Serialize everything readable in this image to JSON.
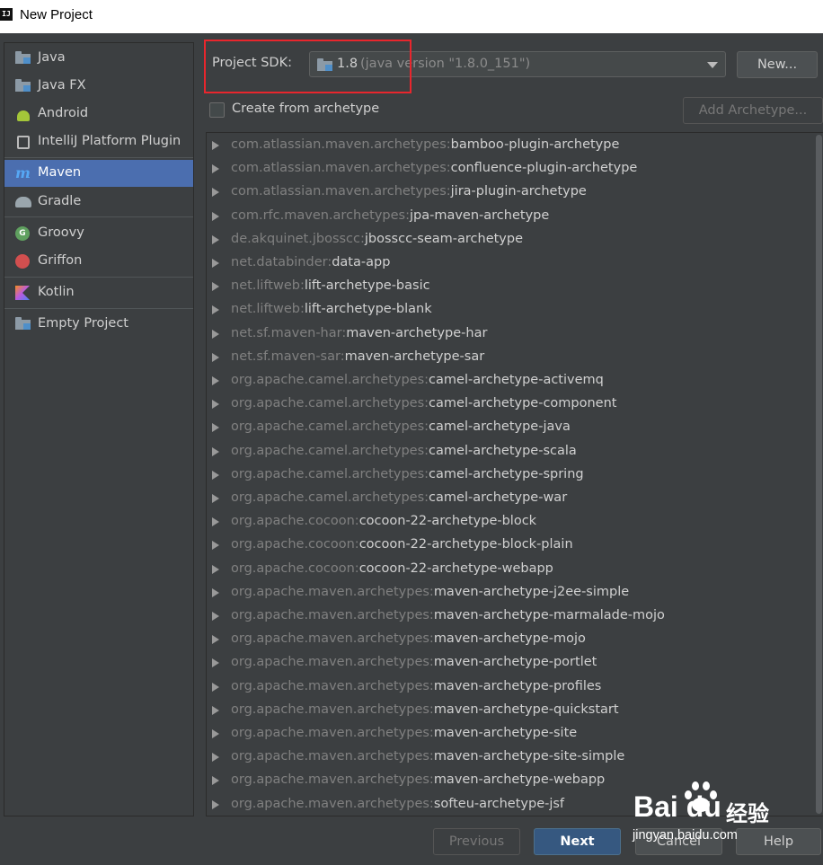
{
  "window": {
    "title": "New Project",
    "app_icon_text": "IJ"
  },
  "sidebar": {
    "items": [
      {
        "label": "Java",
        "icon": "folder-icon"
      },
      {
        "label": "Java FX",
        "icon": "folder-icon"
      },
      {
        "label": "Android",
        "icon": "android-icon"
      },
      {
        "label": "IntelliJ Platform Plugin",
        "icon": "intellij-plugin-icon"
      },
      {
        "label": "Maven",
        "icon": "maven-icon",
        "selected": true
      },
      {
        "label": "Gradle",
        "icon": "gradle-icon"
      },
      {
        "label": "Groovy",
        "icon": "groovy-icon"
      },
      {
        "label": "Griffon",
        "icon": "griffon-icon"
      },
      {
        "label": "Kotlin",
        "icon": "kotlin-icon"
      },
      {
        "label": "Empty Project",
        "icon": "folder-icon"
      }
    ]
  },
  "sdk": {
    "label": "Project SDK:",
    "value": "1.8",
    "hint": "(java version \"1.8.0_151\")",
    "new_button": "New..."
  },
  "archetype": {
    "checkbox_label": "Create from archetype",
    "checked": false,
    "add_button": "Add Archetype..."
  },
  "archetypes": [
    {
      "group": "com.atlassian.maven.archetypes:",
      "artifact": "bamboo-plugin-archetype"
    },
    {
      "group": "com.atlassian.maven.archetypes:",
      "artifact": "confluence-plugin-archetype"
    },
    {
      "group": "com.atlassian.maven.archetypes:",
      "artifact": "jira-plugin-archetype"
    },
    {
      "group": "com.rfc.maven.archetypes:",
      "artifact": "jpa-maven-archetype"
    },
    {
      "group": "de.akquinet.jbosscc:",
      "artifact": "jbosscc-seam-archetype"
    },
    {
      "group": "net.databinder:",
      "artifact": "data-app"
    },
    {
      "group": "net.liftweb:",
      "artifact": "lift-archetype-basic"
    },
    {
      "group": "net.liftweb:",
      "artifact": "lift-archetype-blank"
    },
    {
      "group": "net.sf.maven-har:",
      "artifact": "maven-archetype-har"
    },
    {
      "group": "net.sf.maven-sar:",
      "artifact": "maven-archetype-sar"
    },
    {
      "group": "org.apache.camel.archetypes:",
      "artifact": "camel-archetype-activemq"
    },
    {
      "group": "org.apache.camel.archetypes:",
      "artifact": "camel-archetype-component"
    },
    {
      "group": "org.apache.camel.archetypes:",
      "artifact": "camel-archetype-java"
    },
    {
      "group": "org.apache.camel.archetypes:",
      "artifact": "camel-archetype-scala"
    },
    {
      "group": "org.apache.camel.archetypes:",
      "artifact": "camel-archetype-spring"
    },
    {
      "group": "org.apache.camel.archetypes:",
      "artifact": "camel-archetype-war"
    },
    {
      "group": "org.apache.cocoon:",
      "artifact": "cocoon-22-archetype-block"
    },
    {
      "group": "org.apache.cocoon:",
      "artifact": "cocoon-22-archetype-block-plain"
    },
    {
      "group": "org.apache.cocoon:",
      "artifact": "cocoon-22-archetype-webapp"
    },
    {
      "group": "org.apache.maven.archetypes:",
      "artifact": "maven-archetype-j2ee-simple"
    },
    {
      "group": "org.apache.maven.archetypes:",
      "artifact": "maven-archetype-marmalade-mojo"
    },
    {
      "group": "org.apache.maven.archetypes:",
      "artifact": "maven-archetype-mojo"
    },
    {
      "group": "org.apache.maven.archetypes:",
      "artifact": "maven-archetype-portlet"
    },
    {
      "group": "org.apache.maven.archetypes:",
      "artifact": "maven-archetype-profiles"
    },
    {
      "group": "org.apache.maven.archetypes:",
      "artifact": "maven-archetype-quickstart"
    },
    {
      "group": "org.apache.maven.archetypes:",
      "artifact": "maven-archetype-site"
    },
    {
      "group": "org.apache.maven.archetypes:",
      "artifact": "maven-archetype-site-simple"
    },
    {
      "group": "org.apache.maven.archetypes:",
      "artifact": "maven-archetype-webapp"
    },
    {
      "group": "org.apache.maven.archetypes:",
      "artifact": "softeu-archetype-jsf"
    }
  ],
  "footer": {
    "previous": "Previous",
    "next": "Next",
    "cancel": "Cancel",
    "help": "Help"
  },
  "watermark": {
    "brand": "Bai du",
    "cn": "经验",
    "url": "jingyan.baidu.com"
  },
  "colors": {
    "background": "#3c3f41",
    "selection": "#4b6eaf",
    "highlight_box": "#e8262d",
    "primary_button": "#365880"
  }
}
